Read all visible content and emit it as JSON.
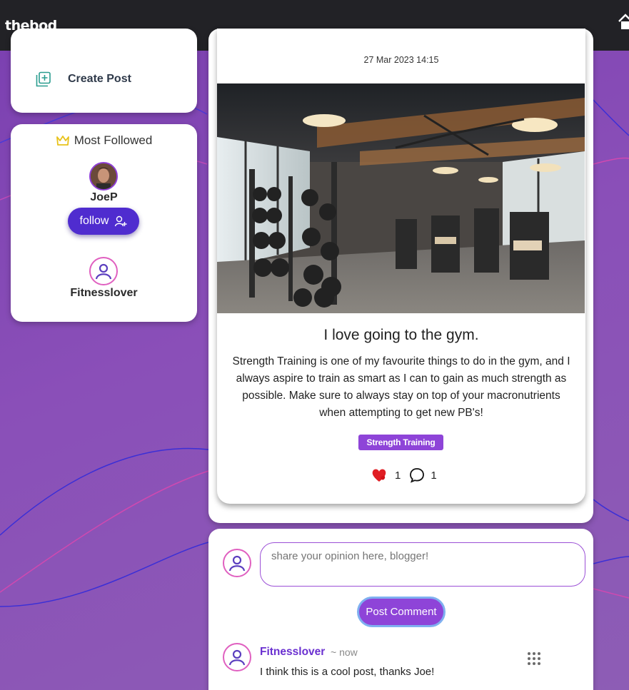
{
  "header": {
    "brand": "thebod",
    "home_icon": "home-icon"
  },
  "sidebar": {
    "create_post_label": "Create Post",
    "create_post_icon": "add-box-icon",
    "most_followed": {
      "title": "Most Followed",
      "title_icon": "crown-icon",
      "users": [
        {
          "name": "JoeP",
          "has_follow_button": true
        },
        {
          "name": "Fitnesslover",
          "has_follow_button": false
        }
      ],
      "follow_label": "follow"
    }
  },
  "post": {
    "date": "27 Mar 2023 14:15",
    "title": "I love going to the gym.",
    "body": "Strength Training is one of my favourite things to do in the gym, and I always aspire to train as smart as I can to gain as much strength as possible. Make sure to always stay on top of your macronutrients when attempting to get new PB's!",
    "tag": "Strength Training",
    "likes": "1",
    "comments": "1"
  },
  "comment_form": {
    "placeholder": "share your opinion here, blogger!",
    "submit_label": "Post Comment"
  },
  "comments": [
    {
      "author": "Fitnesslover",
      "time": "~ now",
      "text": "I think this is a cool post, thanks Joe!"
    }
  ],
  "colors": {
    "accent": "#8e44d8",
    "follow_button": "#4f2ccf",
    "header_bg": "#222226",
    "crown": "#e8c21a"
  }
}
